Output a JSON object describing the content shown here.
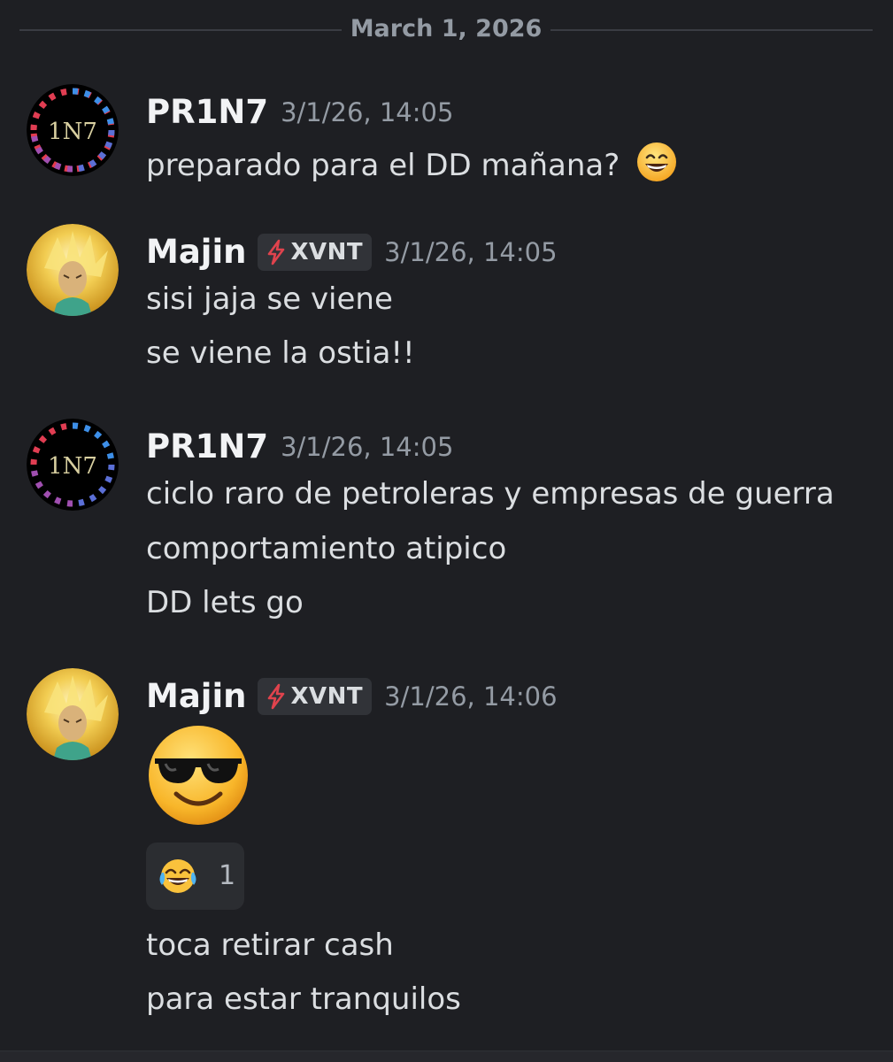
{
  "date_divider": "March 1, 2026",
  "messages": [
    {
      "author": "PR1N7",
      "avatar_text": "1N7",
      "timestamp": "3/1/26, 14:05",
      "lines": [
        "preparado para el DD mañana?"
      ],
      "trailing_emoji": "grinning-face-with-smiling-eyes"
    },
    {
      "author": "Majin",
      "tag": "XVNT",
      "tag_icon": "lightning-bolt-icon",
      "timestamp": "3/1/26, 14:05",
      "lines": [
        "sisi jaja se viene",
        "se viene la ostia!!"
      ]
    },
    {
      "author": "PR1N7",
      "avatar_text": "1N7",
      "timestamp": "3/1/26, 14:05",
      "lines": [
        "ciclo raro de petroleras y empresas de guerra",
        "comportamiento atipico",
        "DD lets go"
      ]
    },
    {
      "author": "Majin",
      "tag": "XVNT",
      "tag_icon": "lightning-bolt-icon",
      "timestamp": "3/1/26, 14:06",
      "jumbo_emoji": "smiling-face-with-sunglasses",
      "reaction": {
        "emoji": "face-with-tears-of-joy",
        "count": "1"
      },
      "lines": [
        "toca retirar cash",
        "para estar tranquilos"
      ]
    }
  ],
  "colors": {
    "background": "#1e1f23",
    "username": "#f2f3f5",
    "text": "#dbdee1",
    "muted": "#949ba4",
    "tag_bg": "#313338",
    "bolt": "#e0434d"
  }
}
